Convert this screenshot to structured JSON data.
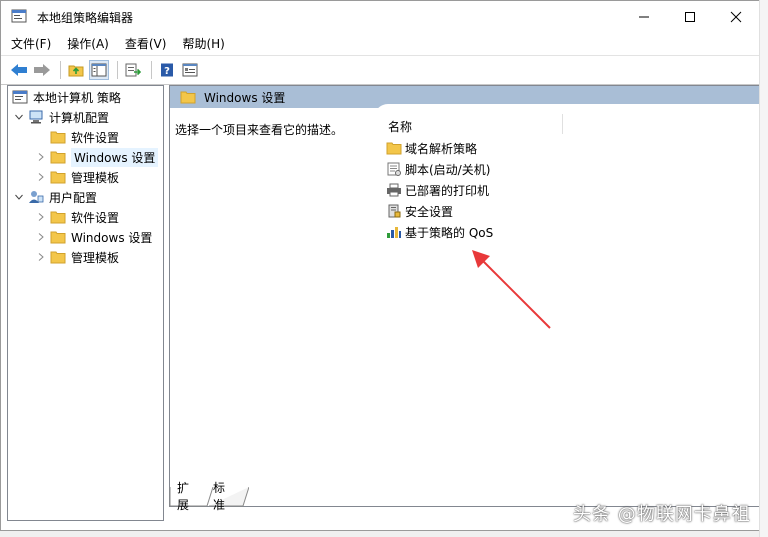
{
  "window": {
    "title": "本地组策略编辑器"
  },
  "menu": [
    {
      "label": "文件(F)"
    },
    {
      "label": "操作(A)"
    },
    {
      "label": "查看(V)"
    },
    {
      "label": "帮助(H)"
    }
  ],
  "toolbar": {
    "icons": [
      "back-arrow-icon",
      "forward-arrow-icon",
      "up-folder-icon",
      "show-tree-icon",
      "export-list-icon",
      "help-icon",
      "properties-icon"
    ]
  },
  "tree": {
    "root": "本地计算机 策略",
    "computer": "计算机配置",
    "computer_children": [
      "软件设置",
      "Windows 设置",
      "管理模板"
    ],
    "user": "用户配置",
    "user_children": [
      "软件设置",
      "Windows 设置",
      "管理模板"
    ]
  },
  "details": {
    "header": "Windows 设置",
    "description": "选择一个项目来查看它的描述。",
    "column_name": "名称",
    "items": [
      {
        "label": "域名解析策略",
        "icon": "folder-icon"
      },
      {
        "label": "脚本(启动/关机)",
        "icon": "script-icon"
      },
      {
        "label": "已部署的打印机",
        "icon": "printer-icon"
      },
      {
        "label": "安全设置",
        "icon": "security-icon"
      },
      {
        "label": "基于策略的 QoS",
        "icon": "qos-chart-icon"
      }
    ]
  },
  "tabs": [
    {
      "label": "扩展"
    },
    {
      "label": "标准"
    }
  ],
  "watermark": "头条 @物联网卡鼻祖",
  "colors": {
    "header_bg": "#a9bed6",
    "folder": "#f3c64a",
    "annotation_arrow": "#e8393a",
    "selection": "#e5f3ff"
  }
}
